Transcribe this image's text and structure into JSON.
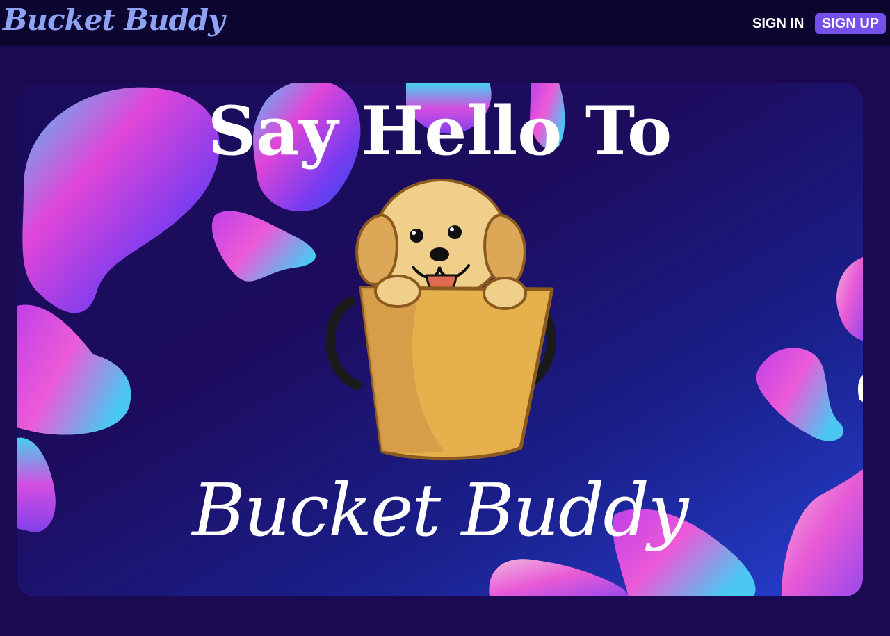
{
  "header": {
    "logo_text": "Bucket Buddy",
    "sign_in_label": "SIGN IN",
    "sign_up_label": "SIGN UP"
  },
  "hero": {
    "title": "Say Hello To",
    "brand": "Bucket Buddy"
  },
  "colors": {
    "logo": "#8fa2f2",
    "topbar": "#0b0530",
    "page_background": "#1b0a52",
    "sign_up_button": "#7650ea",
    "text": "#ffffff"
  },
  "icons": {
    "mascot": "dog-in-bucket-illustration"
  }
}
